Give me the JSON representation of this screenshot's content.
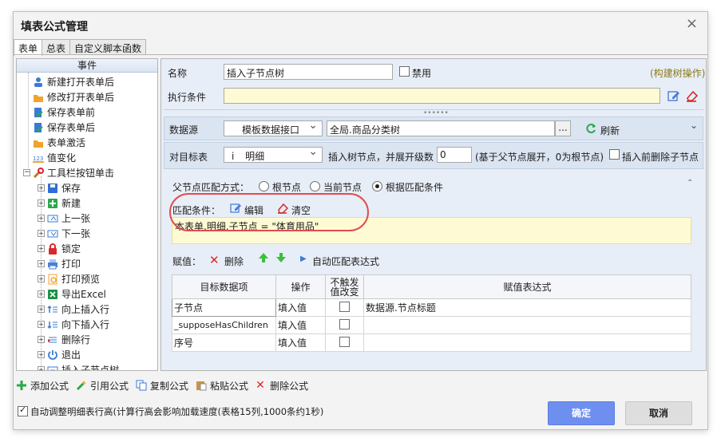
{
  "window": {
    "title": "填表公式管理",
    "close_glyph": "×"
  },
  "tabs": [
    {
      "label": "表单"
    },
    {
      "label": "总表"
    },
    {
      "label": "自定义脚本函数"
    }
  ],
  "events_panel": {
    "header": "事件",
    "items": [
      {
        "label": "新建打开表单后",
        "icon": "user-new-icon"
      },
      {
        "label": "修改打开表单后",
        "icon": "folder-open-icon"
      },
      {
        "label": "保存表单前",
        "icon": "doc-check-icon"
      },
      {
        "label": "保存表单后",
        "icon": "doc-check-icon"
      },
      {
        "label": "表单激活",
        "icon": "folder-open-icon"
      },
      {
        "label": "值变化",
        "icon": "value-123-icon"
      },
      {
        "label": "工具栏按钮单击",
        "icon": "tools-icon"
      },
      {
        "label": "保存",
        "icon": "save-icon"
      },
      {
        "label": "新建",
        "icon": "new-icon"
      },
      {
        "label": "上一张",
        "icon": "prev-icon"
      },
      {
        "label": "下一张",
        "icon": "next-icon"
      },
      {
        "label": "锁定",
        "icon": "lock-icon"
      },
      {
        "label": "打印",
        "icon": "print-icon"
      },
      {
        "label": "打印预览",
        "icon": "print-preview-icon"
      },
      {
        "label": "导出Excel",
        "icon": "excel-icon"
      },
      {
        "label": "向上插入行",
        "icon": "insert-up-icon"
      },
      {
        "label": "向下插入行",
        "icon": "insert-down-icon"
      },
      {
        "label": "删除行",
        "icon": "delete-row-icon"
      },
      {
        "label": "退出",
        "icon": "exit-icon"
      },
      {
        "label": "插入子节点树",
        "icon": "tree-insert-icon"
      }
    ]
  },
  "form": {
    "name_label": "名称",
    "name_value": "插入子节点树",
    "disable_label": "禁用",
    "build_tree_link": "(构建树操作)",
    "exec_cond_label": "执行条件",
    "exec_cond_value": "",
    "datasource_label": "数据源",
    "datasource_type": "模板数据接口",
    "datasource_value": "全局.商品分类树",
    "browse_label": "...",
    "refresh_label": "刷新",
    "target_table_label": "对目标表",
    "target_table_value": "明细",
    "target_table_prefix": "i",
    "insert_tree_label": "插入树节点，并展开级数",
    "expand_level": "0",
    "expand_note": "(基于父节点展开，0为根节点)",
    "delete_before_label": "插入前删除子节点",
    "parent_match_label": "父节点匹配方式：",
    "radio_root": "根节点",
    "radio_current": "当前节点",
    "radio_cond": "根据匹配条件",
    "match_cond_label": "匹配条件：",
    "edit_label": "编辑",
    "clear_label": "清空",
    "match_expr": "本表单.明细.子节点 = \"体育用品\"",
    "assign_label": "赋值：",
    "delete_label": "删除",
    "auto_match_label": "自动匹配表达式"
  },
  "grid": {
    "headers": [
      "目标数据项",
      "操作",
      "不触发值改变",
      "赋值表达式"
    ],
    "rows": [
      {
        "target": "子节点",
        "op": "填入值",
        "no_trigger": false,
        "expr": "数据源.节点标题"
      },
      {
        "target": "_supposeHasChildren",
        "op": "填入值",
        "no_trigger": false,
        "expr": ""
      },
      {
        "target": "序号",
        "op": "填入值",
        "no_trigger": false,
        "expr": ""
      }
    ]
  },
  "toolbar": {
    "add_label": "添加公式",
    "ref_label": "引用公式",
    "copy_label": "复制公式",
    "paste_label": "粘贴公式",
    "delete_label": "删除公式"
  },
  "footer": {
    "auto_height_label": "自动调整明细表行高(计算行高会影响加载速度(表格15列,1000条约1秒)",
    "auto_height_checked": true,
    "ok_label": "确定",
    "cancel_label": "取消"
  },
  "colors": {
    "accent": "#6e8ff0",
    "highlight_circle": "#e04c4c",
    "yellow_field": "#fefbd4"
  }
}
